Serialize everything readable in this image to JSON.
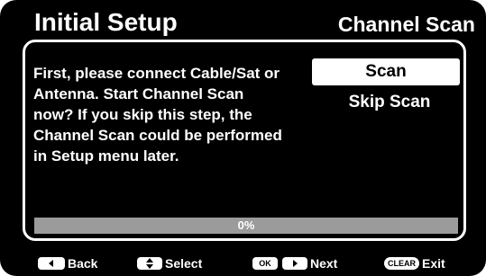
{
  "header": {
    "title": "Initial Setup",
    "section": "Channel Scan"
  },
  "dialog": {
    "message": "First, please connect Cable/Sat or\nAntenna. Start Channel Scan\nnow? If you skip this step, the\nChannel Scan could be performed\nin Setup menu later.",
    "options": [
      {
        "label": "Scan",
        "selected": true
      },
      {
        "label": "Skip Scan",
        "selected": false
      }
    ]
  },
  "progress": {
    "value": 0,
    "label": "0%",
    "track_color": "#9b9b9b",
    "fill_color": "#3a7bd5"
  },
  "footer": {
    "back": {
      "key_icon": "left-arrow-icon",
      "label": "Back"
    },
    "select": {
      "key_icon": "up-down-arrow-icon",
      "label": "Select"
    },
    "next": {
      "key_text": "OK",
      "key_icon": "right-arrow-icon",
      "label": "Next"
    },
    "exit": {
      "key_text": "CLEAR",
      "label": "Exit"
    }
  },
  "colors": {
    "background": "#000000",
    "text": "#ffffff",
    "highlight": "#ffffff",
    "highlight_text": "#000000"
  }
}
